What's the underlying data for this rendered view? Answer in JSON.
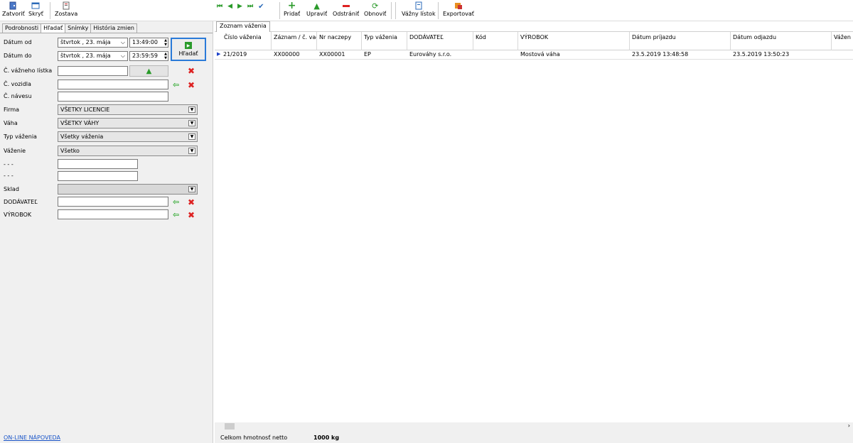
{
  "toolbar": {
    "close": "Zatvoriť",
    "hide": "Skryť",
    "report": "Zostava",
    "add": "Pridať",
    "edit": "Upraviť",
    "delete": "Odstrániť",
    "refresh": "Obnoviť",
    "ticket": "Vážny lístok",
    "export": "Exportovať"
  },
  "left_tabs": [
    "Podrobnosti",
    "Hľadať",
    "Snímky",
    "História zmien"
  ],
  "filters": {
    "date_from_label": "Dátum od",
    "date_from_value": "štvrtok  ,  23.       mája",
    "time_from": "13:49:00",
    "date_to_label": "Dátum do",
    "date_to_value": "štvrtok  ,  23.       mája",
    "time_to": "23:59:59",
    "search_button": "Hľadať",
    "ticket_no_label": "Č. vážneho lístka",
    "vehicle_label": "Č. vozidla",
    "trailer_label": "Č. návesu",
    "firm_label": "Firma",
    "firm_value": "VŠETKY LICENCIE",
    "scale_label": "Váha",
    "scale_value": "VŠETKY VÁHY",
    "weigh_type_label": "Typ váženia",
    "weigh_type_value": "Všetky váženia",
    "weighing_label": "Váženie",
    "weighing_value": "Všetko",
    "dash1_label": "- - -",
    "dash2_label": "- - -",
    "warehouse_label": "Sklad",
    "supplier_label": "DODÁVATEĽ",
    "product_label": "VÝROBOK"
  },
  "help_link": "ON-LINE NÁPOVEDA",
  "right_tab": "Zoznam váženia",
  "columns": [
    "Číslo váženia",
    "Záznam / č. vag",
    "Nr naczepy",
    "Typ váženia",
    "DODÁVATEĽ",
    "Kód",
    "VÝROBOK",
    "Dátum príjazdu",
    "Dátum odjazdu",
    "Vážen"
  ],
  "rows": [
    [
      "21/2019",
      "XX00000",
      "XX00001",
      "EP",
      "Eurováhy s.r.o.",
      "",
      "Mostová váha",
      "23.5.2019 13:48:58",
      "23.5.2019 13:50:23",
      ""
    ]
  ],
  "status": {
    "label": "Celkom hmotnosť netto",
    "value": "1000 kg"
  },
  "colors": {
    "accent_green": "#3a3",
    "delete_red": "#d22",
    "link_blue": "#1a55c8"
  }
}
